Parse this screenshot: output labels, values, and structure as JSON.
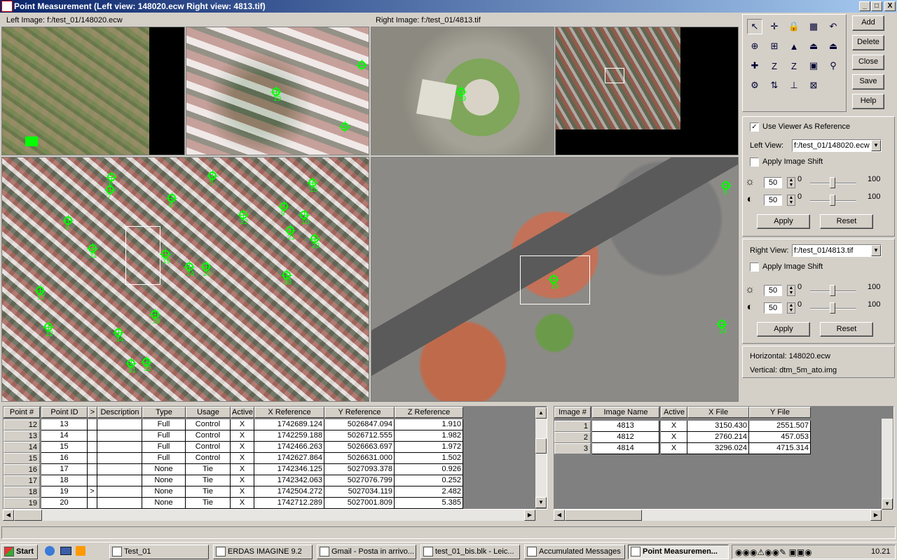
{
  "window": {
    "title": "Point Measurement (Left view: 148020.ecw  Right view: 4813.tif)",
    "min": "_",
    "max": "□",
    "close": "X"
  },
  "left_image_label": "Left Image: f:/test_01/148020.ecw",
  "right_image_label": "Right Image: f:/test_01/4813.tif",
  "left_main_markers": [
    "6",
    "5",
    "15",
    "7",
    "8",
    "6",
    "9",
    "10",
    "22",
    "21",
    "23",
    "11",
    "19",
    "20",
    "14",
    "33",
    "17",
    "18",
    "12",
    "34",
    "31",
    "32"
  ],
  "right_main_markers": [
    "19",
    "5",
    "24"
  ],
  "left_zoom_marker": "19",
  "right_zoom_marker": "19",
  "buttons": {
    "add": "Add",
    "delete": "Delete",
    "close": "Close",
    "save": "Save",
    "help": "Help"
  },
  "tools": [
    "select-arrow-icon",
    "crosshair-icon",
    "lock-icon",
    "grid-icon",
    "undo-icon",
    "zoom-link-icon",
    "create-point-icon",
    "triangle-icon",
    "drive-icon",
    "drive2-icon",
    "add-point-icon",
    "z-icon",
    "z-sub-icon",
    "color-box-icon",
    "link-icon",
    "globe-icon",
    "swap-icon",
    "tie-icon",
    "magnify-icon"
  ],
  "tool_glyphs": [
    "↖",
    "✛",
    "🔒",
    "▦",
    "↶",
    "⊕",
    "⊞",
    "▲",
    "⏏",
    "⏏",
    "✚",
    "Z",
    "Z",
    "▣",
    "⚲",
    "⚙",
    "⇅",
    "⊥",
    "⊠"
  ],
  "use_viewer_ref": {
    "label": "Use Viewer As Reference",
    "checked": "✓"
  },
  "left_view": {
    "label": "Left View:",
    "value": "f:/test_01/148020.ecw",
    "shift_label": "Apply Image Shift",
    "brightness": "50",
    "contrast": "50",
    "min": "0",
    "max": "100",
    "apply": "Apply",
    "reset": "Reset"
  },
  "right_view": {
    "label": "Right View:",
    "value": "f:/test_01/4813.tif",
    "shift_label": "Apply Image Shift",
    "brightness": "50",
    "contrast": "50",
    "min": "0",
    "max": "100",
    "apply": "Apply",
    "reset": "Reset"
  },
  "info": {
    "horizontal": "Horizontal: 148020.ecw",
    "vertical": "Vertical: dtm_5m_ato.img"
  },
  "points_table": {
    "headers": [
      "Point #",
      "Point ID",
      ">",
      "Description",
      "Type",
      "Usage",
      "Active",
      "X Reference",
      "Y Reference",
      "Z Reference"
    ],
    "rows": [
      [
        "12",
        "13",
        "",
        "",
        "Full",
        "Control",
        "X",
        "1742689.124",
        "5026847.094",
        "1.910"
      ],
      [
        "13",
        "14",
        "",
        "",
        "Full",
        "Control",
        "X",
        "1742259.188",
        "5026712.555",
        "1.982"
      ],
      [
        "14",
        "15",
        "",
        "",
        "Full",
        "Control",
        "X",
        "1742466.263",
        "5026663.697",
        "1.972"
      ],
      [
        "15",
        "16",
        "",
        "",
        "Full",
        "Control",
        "X",
        "1742627.864",
        "5026631.000",
        "1.502"
      ],
      [
        "16",
        "17",
        "",
        "",
        "None",
        "Tie",
        "X",
        "1742346.125",
        "5027093.378",
        "0.926"
      ],
      [
        "17",
        "18",
        "",
        "",
        "None",
        "Tie",
        "X",
        "1742342.063",
        "5027076.799",
        "0.252"
      ],
      [
        "18",
        "19",
        ">",
        "",
        "None",
        "Tie",
        "X",
        "1742504.272",
        "5027034.119",
        "2.482"
      ],
      [
        "19",
        "20",
        "",
        "",
        "None",
        "Tie",
        "X",
        "1742712.289",
        "5027001.809",
        "5.385"
      ]
    ]
  },
  "images_table": {
    "headers": [
      "Image #",
      "Image Name",
      "Active",
      "X File",
      "Y File"
    ],
    "rows": [
      [
        "1",
        "4813",
        "X",
        "3150.430",
        "2551.507"
      ],
      [
        "2",
        "4812",
        "X",
        "2760.214",
        "457.053"
      ],
      [
        "3",
        "4814",
        "X",
        "3296.024",
        "4715.314"
      ]
    ]
  },
  "taskbar": {
    "start": "Start",
    "tasks": [
      "Test_01",
      "ERDAS IMAGINE 9.2",
      "Gmail - Posta in arrivo...",
      "test_01_bis.blk - Leic...",
      "Accumulated Messages",
      "Point Measuremen..."
    ],
    "clock": "10.21"
  }
}
